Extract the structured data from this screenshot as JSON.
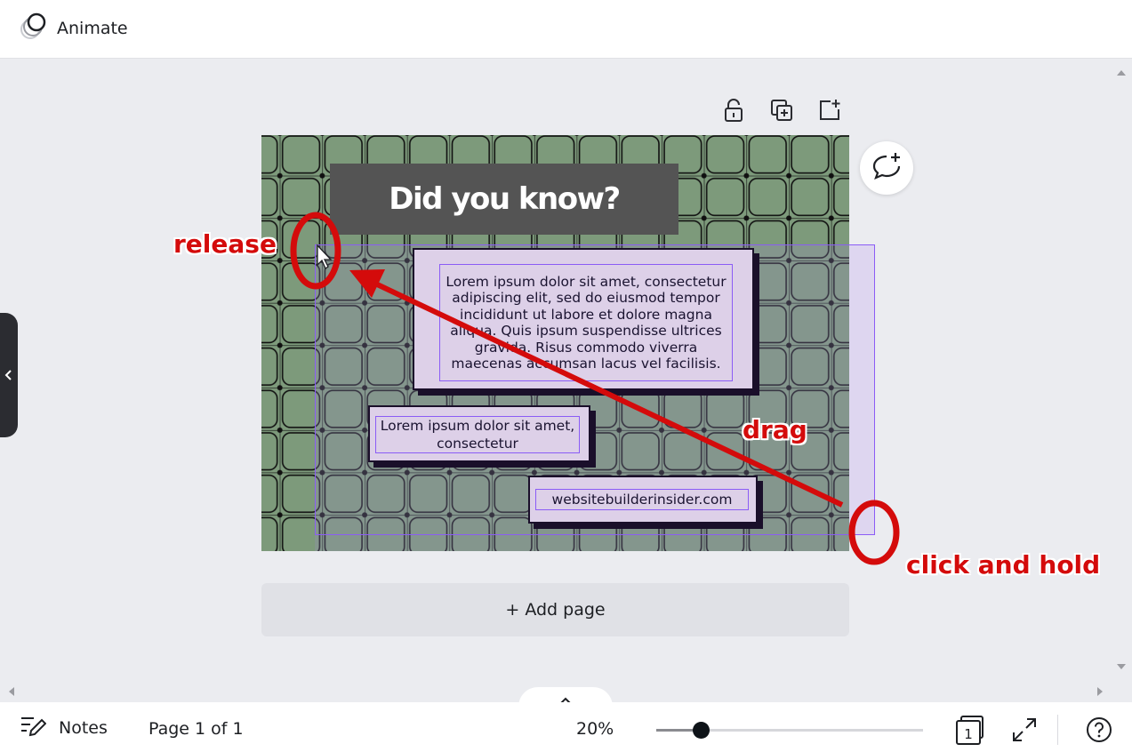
{
  "topbar": {
    "animate_label": "Animate"
  },
  "canvas": {
    "title": "Did you know?",
    "card_main_text": "Lorem ipsum dolor sit amet, consectetur adipiscing elit, sed do eiusmod tempor incididunt ut labore et dolore magna aliqua. Quis ipsum suspendisse ultrices gravida. Risus commodo viverra maecenas accumsan lacus vel facilisis.",
    "card_small_text": "Lorem ipsum dolor sit amet, consectetur",
    "card_url_text": "websitebuilderinsider.com",
    "colors": {
      "background": "#7d9a7b",
      "title_box": "#545454",
      "card": "#ddd0e8",
      "selection": "#8b5cf6"
    }
  },
  "add_page_label": "+ Add page",
  "annotations": {
    "release": "release",
    "drag": "drag",
    "click_and_hold": "click and hold",
    "color": "#d40b0b"
  },
  "bottombar": {
    "notes_label": "Notes",
    "page_info": "Page 1 of 1",
    "zoom": "20%",
    "zoom_fraction": 0.17,
    "page_count": "1"
  },
  "icons": {
    "animate": "animate-icon",
    "lock": "lock-icon",
    "duplicate": "duplicate-page-icon",
    "add_page": "add-page-icon",
    "comment": "add-comment-icon",
    "notes": "notes-icon",
    "pages": "page-count-icon",
    "fullscreen": "fullscreen-icon",
    "help": "help-icon"
  }
}
